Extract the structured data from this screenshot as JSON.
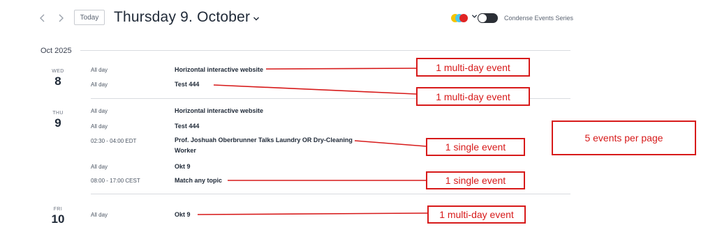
{
  "header": {
    "prev_icon": "chevron-left-icon",
    "next_icon": "chevron-right-icon",
    "today_label": "Today",
    "date_title": "Thursday 9. October",
    "dropdown_icon": "chevron-down-icon",
    "color_dots": [
      "#f5c400",
      "#48c8ee",
      "#e02424"
    ],
    "toggle_label": "Condense Events Series"
  },
  "month": {
    "label": "Oct 2025"
  },
  "days": [
    {
      "dow": "WED",
      "num": "8",
      "events": [
        {
          "time": "All day",
          "title": "Horizontal interactive website"
        },
        {
          "time": "All day",
          "title": "Test 444"
        }
      ]
    },
    {
      "dow": "THU",
      "num": "9",
      "events": [
        {
          "time": "All day",
          "title": "Horizontal interactive website"
        },
        {
          "time": "All day",
          "title": "Test 444"
        },
        {
          "time": "02:30 - 04:00 EDT",
          "title": "Prof. Joshuah Oberbrunner Talks Laundry OR Dry-Cleaning Worker"
        },
        {
          "time": "All day",
          "title": "Okt 9"
        },
        {
          "time": "08:00 - 17:00 CEST",
          "title": "Match any topic"
        }
      ]
    },
    {
      "dow": "FRI",
      "num": "10",
      "events": [
        {
          "time": "All day",
          "title": "Okt 9"
        }
      ]
    }
  ],
  "annotations": [
    "1 multi-day event",
    "1 multi-day event",
    "1 single event",
    "1 single event",
    "1 multi-day event",
    "5 events per page"
  ],
  "colors": {
    "annotation": "#d71a1a"
  }
}
